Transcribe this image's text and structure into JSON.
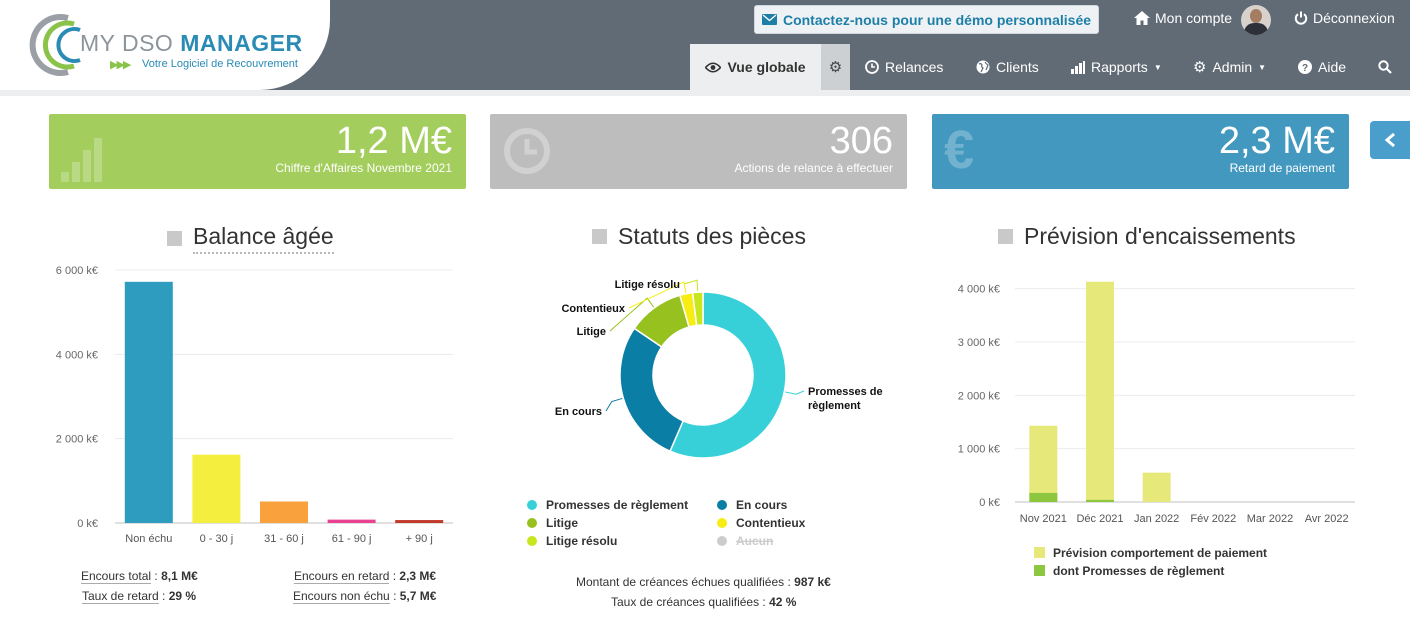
{
  "header": {
    "brand_light": "MY DSO",
    "brand_bold": "MANAGER",
    "tagline": "Votre Logiciel de Recouvrement",
    "demo_button": "Contactez-nous pour une démo personnalisée",
    "account": "Mon compte",
    "logout": "Déconnexion"
  },
  "nav": {
    "overview": "Vue globale",
    "reminders": "Relances",
    "clients": "Clients",
    "reports": "Rapports",
    "admin": "Admin",
    "help": "Aide"
  },
  "kpis": [
    {
      "value": "1,2 M€",
      "label": "Chiffre d'Affaires Novembre 2021",
      "color": "#a3cd5c"
    },
    {
      "value": "306",
      "label": "Actions de relance à effectuer",
      "color": "#bdbdbd"
    },
    {
      "value": "2,3 M€",
      "label": "Retard de paiement",
      "color": "#4398bf"
    }
  ],
  "aged_balance": {
    "title": "Balance âgée",
    "stats": {
      "total_label": "Encours total",
      "total_value": "8,1 M€",
      "late_label": "Encours en retard",
      "late_value": "2,3 M€",
      "rate_label": "Taux de retard",
      "rate_value": "29 %",
      "not_due_label": "Encours non échu",
      "not_due_value": "5,7 M€"
    }
  },
  "status": {
    "title": "Statuts des pièces",
    "stats": {
      "amount_label": "Montant de créances échues qualifiées",
      "amount_value": "987 k€",
      "rate_label": "Taux de créances qualifiées",
      "rate_value": "42 %"
    }
  },
  "forecast": {
    "title": "Prévision d'encaissements"
  },
  "chart_data": [
    {
      "type": "bar",
      "categories": [
        "Non échu",
        "0 - 30 j",
        "31 - 60 j",
        "61 - 90 j",
        "+ 90 j"
      ],
      "values": [
        5720,
        1620,
        510,
        80,
        70
      ],
      "colors": [
        "#2e9cbf",
        "#f4ee3e",
        "#f9a13c",
        "#e84393",
        "#c0392b"
      ],
      "y_ticks": [
        0,
        2000,
        4000,
        6000
      ],
      "y_tick_labels": [
        "0 k€",
        "2 000 k€",
        "4 000 k€",
        "6 000 k€"
      ],
      "ylim": [
        0,
        6000
      ]
    },
    {
      "type": "pie",
      "hole": true,
      "slices": [
        {
          "name": "Promesses de règlement",
          "value": 56.5,
          "color": "#37d0d9",
          "label": "Promesses de règlement"
        },
        {
          "name": "En cours",
          "value": 28,
          "color": "#0a7ea4",
          "label": "En cours"
        },
        {
          "name": "Litige",
          "value": 11,
          "color": "#96c11f",
          "label": "Litige"
        },
        {
          "name": "Contentieux",
          "value": 2.5,
          "color": "#f7ec13",
          "label": "Contentieux"
        },
        {
          "name": "Litige résolu",
          "value": 2,
          "color": "#c8e61d",
          "label": "Litige résolu"
        }
      ],
      "legend": [
        {
          "name": "Promesses de règlement",
          "color": "#37d0d9",
          "enabled": true
        },
        {
          "name": "En cours",
          "color": "#0a7ea4",
          "enabled": true
        },
        {
          "name": "Litige",
          "color": "#96c11f",
          "enabled": true
        },
        {
          "name": "Contentieux",
          "color": "#f7ec13",
          "enabled": true
        },
        {
          "name": "Litige résolu",
          "color": "#c8e61d",
          "enabled": true
        },
        {
          "name": "Aucun",
          "color": "#cccccc",
          "enabled": false
        }
      ]
    },
    {
      "type": "bar",
      "categories": [
        "Nov 2021",
        "Déc 2021",
        "Jan 2022",
        "Fév 2022",
        "Mar 2022",
        "Avr 2022"
      ],
      "series": [
        {
          "name": "Prévision comportement de paiement",
          "values": [
            1430,
            4130,
            550,
            0,
            0,
            0
          ],
          "color": "#e6e87a"
        },
        {
          "name": "dont Promesses de règlement",
          "values": [
            170,
            40,
            0,
            0,
            0,
            0
          ],
          "color": "#8dc63f"
        }
      ],
      "y_ticks": [
        0,
        1000,
        2000,
        3000,
        4000
      ],
      "y_tick_labels": [
        "0 k€",
        "1 000 k€",
        "2 000 k€",
        "3 000 k€",
        "4 000 k€"
      ],
      "ylim": [
        0,
        4200
      ]
    }
  ]
}
